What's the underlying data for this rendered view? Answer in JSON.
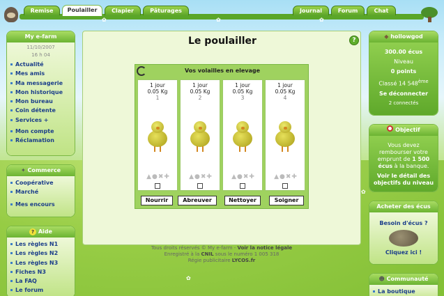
{
  "tabs_left": [
    "Remise",
    "Poulailler",
    "Clapier",
    "Pâturages"
  ],
  "tabs_right": [
    "Journal",
    "Forum",
    "Chat"
  ],
  "active_tab": "Poulailler",
  "sidebar_main": {
    "title": "My e-farm",
    "date": "11/10/2007",
    "time": "16 h 04",
    "items": [
      "Actualité",
      "Mes amis",
      "Ma messagerie",
      "Mon historique",
      "Mon bureau",
      "Coin détente",
      "Services +"
    ],
    "items2": [
      "Mon compte",
      "Réclamation"
    ]
  },
  "sidebar_commerce": {
    "title": "Commerce",
    "items": [
      "Coopérative",
      "Marché",
      "Mes encours"
    ]
  },
  "sidebar_aide": {
    "title": "Aide",
    "items": [
      "Les règles N1",
      "Les règles N2",
      "Les règles N3",
      "Fiches N3",
      "La FAQ",
      "Le forum"
    ]
  },
  "page_title": "Le poulailler",
  "frame_title": "Vos volailles en elevage",
  "birds": [
    {
      "age": "1 jour",
      "weight": "0.05 Kg",
      "num": "1"
    },
    {
      "age": "1 jour",
      "weight": "0.05 Kg",
      "num": "2"
    },
    {
      "age": "1 jour",
      "weight": "0.05 Kg",
      "num": "3"
    },
    {
      "age": "1 jour",
      "weight": "0.05 Kg",
      "num": "4"
    }
  ],
  "actions": [
    "Nourrir",
    "Abreuver",
    "Nettoyer",
    "Soigner"
  ],
  "footer": {
    "line1": "Tous droits réservés © My e-farm - ",
    "notice": "Voir la notice légale",
    "line2_a": "Enregistré à la ",
    "cnil": "CNIL",
    "line2_b": " sous le numéro 1 005 318",
    "line3_a": "Régie publicitaire ",
    "lycos": "LYCOS.fr"
  },
  "user": {
    "name": "hollowgod",
    "money": "300.00 écus",
    "level": "Niveau",
    "points": "0 points",
    "rank_a": "Classé 14 548",
    "rank_sup": "ème",
    "logout": "Se déconnecter",
    "connected": "2 connectés"
  },
  "objectif": {
    "title": "Objectif",
    "line1": "Vous devez",
    "line2": "rembourser votre",
    "line3_a": "emprunt de ",
    "line3_b": "1 500",
    "line4_a": "écus",
    "line4_b": " à la banque.",
    "link1": "Voir le détail des",
    "link2": "objectifs du niveau"
  },
  "ecus": {
    "title": "Acheter des écus",
    "question": "Besoin d'écus ?",
    "cta": "Cliquez ici !"
  },
  "communaute": {
    "title": "Communauté",
    "item": "La boutique"
  }
}
